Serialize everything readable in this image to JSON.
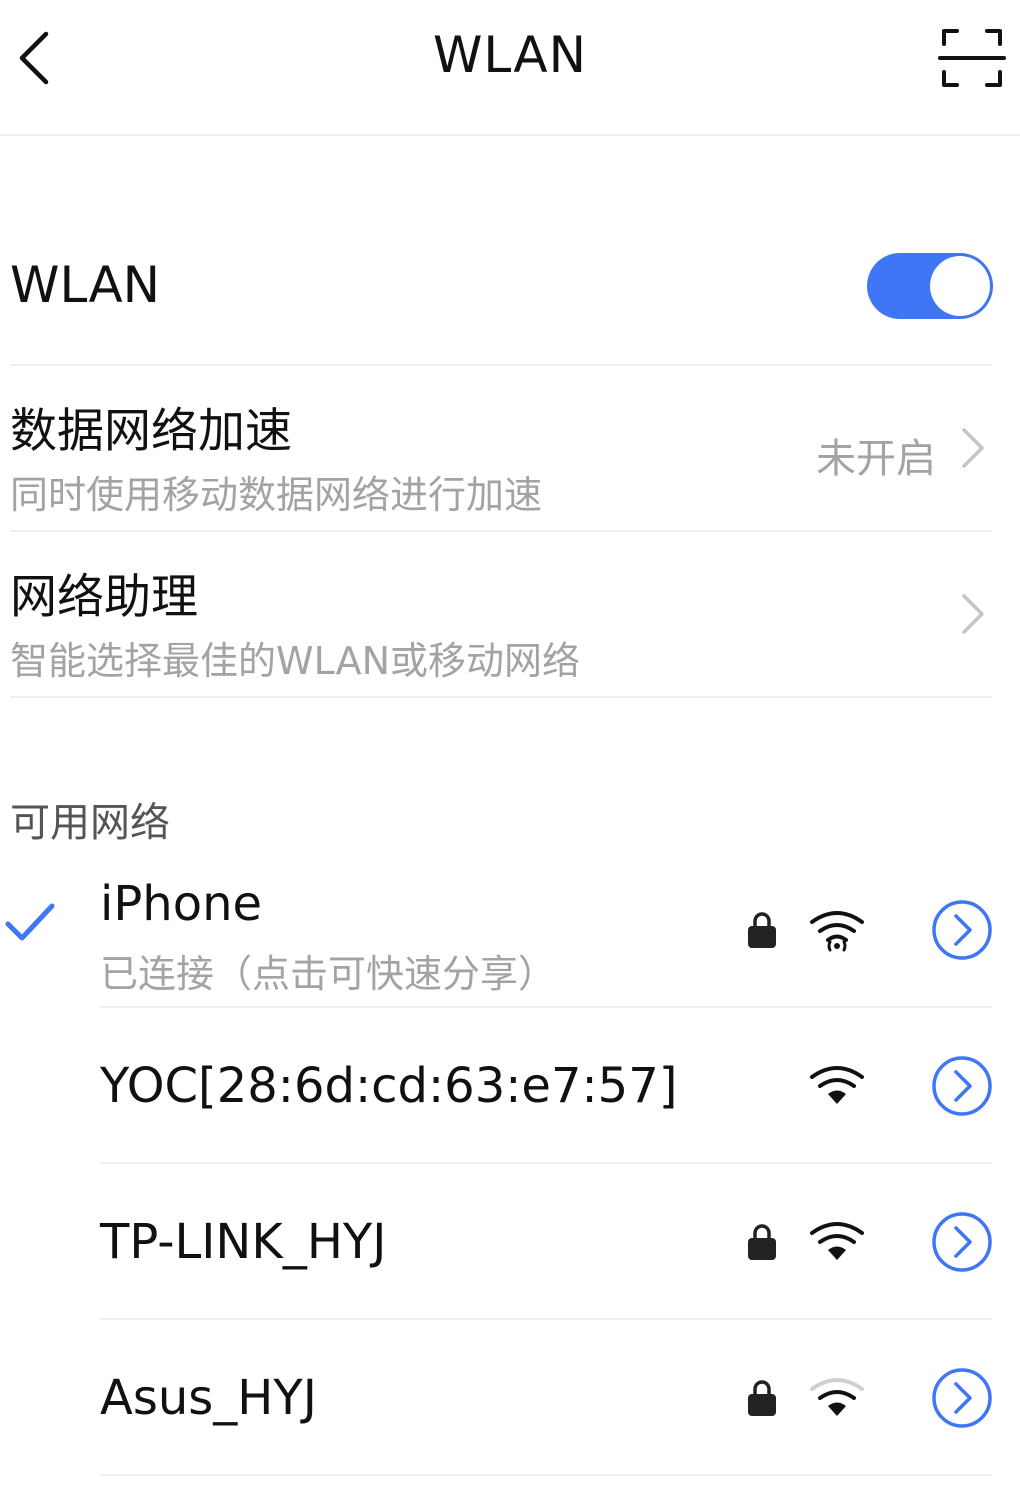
{
  "header": {
    "title": "WLAN",
    "back_icon": "chevron-left-icon",
    "scan_icon": "scan-frame-icon"
  },
  "wlan_toggle": {
    "label": "WLAN",
    "enabled": true,
    "accent_color": "#3f76f5"
  },
  "settings": [
    {
      "title": "数据网络加速",
      "subtitle": "同时使用移动数据网络进行加速",
      "value": "未开启"
    },
    {
      "title": "网络助理",
      "subtitle": "智能选择最佳的WLAN或移动网络",
      "value": ""
    }
  ],
  "available_section": {
    "title": "可用网络"
  },
  "networks": [
    {
      "name": "iPhone",
      "status": "已连接（点击可快速分享）",
      "connected": true,
      "locked": true,
      "signal": "hotspot"
    },
    {
      "name": "YOC[28:6d:cd:63:e7:57]",
      "status": "",
      "connected": false,
      "locked": false,
      "signal": "full"
    },
    {
      "name": "TP-LINK_HYJ",
      "status": "",
      "connected": false,
      "locked": true,
      "signal": "full"
    },
    {
      "name": "Asus_HYJ",
      "status": "",
      "connected": false,
      "locked": true,
      "signal": "medium"
    }
  ],
  "colors": {
    "accent": "#3f76f5",
    "secondary_text": "#a3a3a3",
    "divider": "#eeeeee"
  }
}
